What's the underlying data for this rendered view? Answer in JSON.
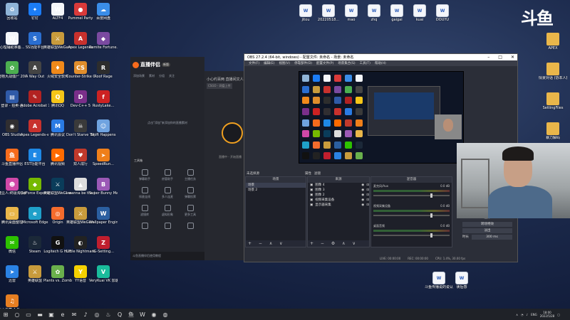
{
  "desktop_left": [
    {
      "label": "回收站",
      "icon": "recycle-bin-icon",
      "color": "#8fb4d8",
      "glyph": "♻"
    },
    {
      "label": "钉钉",
      "icon": "dingtalk-icon",
      "color": "#1b7cf5",
      "glyph": "✦"
    },
    {
      "label": "ALTF4",
      "icon": "document-icon",
      "color": "#f4f6fa",
      "glyph": "W"
    },
    {
      "label": "Pummel Party",
      "icon": "pummel-party-icon",
      "color": "#d93a3a",
      "glyph": "●"
    },
    {
      "label": "百度网盘",
      "icon": "baidu-netdisk-icon",
      "color": "#3a8de8",
      "glyph": "☁"
    },
    {
      "label": "心理辅助准备...",
      "icon": "word-doc-icon",
      "color": "#f4f6fa",
      "glyph": "W"
    },
    {
      "label": "SS功能平台",
      "icon": "ss-icon",
      "color": "#2a6ed0",
      "glyph": "S"
    },
    {
      "label": "英雄联盟WeGame",
      "icon": "lol-icon",
      "color": "#c89b3c",
      "glyph": "⚔"
    },
    {
      "label": "Apex Legends",
      "icon": "apex-icon",
      "color": "#c8312d",
      "glyph": "A"
    },
    {
      "label": "Remite Fortune...",
      "icon": "game-icon",
      "color": "#7a4aa0",
      "glyph": "◆"
    },
    {
      "label": "植物大战僵尸 2002",
      "icon": "pvz-icon",
      "color": "#4caf50",
      "glyph": "✿"
    },
    {
      "label": "A Way Out",
      "icon": "a-way-out-icon",
      "color": "#444",
      "glyph": "A"
    },
    {
      "label": "火绒安全软件",
      "icon": "huorong-icon",
      "color": "#f0891a",
      "glyph": "♦"
    },
    {
      "label": "Counter-Strike Global Off...",
      "icon": "csgo-icon",
      "color": "#e08e2c",
      "glyph": "CS"
    },
    {
      "label": "Roof Rage",
      "icon": "roof-rage-icon",
      "color": "#2d2d2d",
      "glyph": "R"
    },
    {
      "label": "登录 - 拍卖·台",
      "icon": "shortcut-icon",
      "color": "#2f5aa8",
      "glyph": "▤"
    },
    {
      "label": "Adobe Acrobat 7.0",
      "icon": "acrobat-icon",
      "color": "#b22222",
      "glyph": "✎"
    },
    {
      "label": "腾讯QQ",
      "icon": "qq-icon",
      "color": "#f5c518",
      "glyph": "Q"
    },
    {
      "label": "Dev-C++ 5",
      "icon": "devcpp-icon",
      "color": "#7a2f8a",
      "glyph": "D"
    },
    {
      "label": "RustyLake...",
      "icon": "flash-icon",
      "color": "#c22",
      "glyph": "f"
    },
    {
      "label": "OBS Studio",
      "icon": "obs-icon",
      "color": "#302e31",
      "glyph": "◉"
    },
    {
      "label": "Apex Legends-v4",
      "icon": "apex-icon",
      "color": "#c8312d",
      "glyph": "A"
    },
    {
      "label": "腾讯会议",
      "icon": "tencent-meeting-icon",
      "color": "#2a7be4",
      "glyph": "M"
    },
    {
      "label": "Don't Starve Together",
      "icon": "dst-icon",
      "color": "#3a3a3a",
      "glyph": "☠"
    },
    {
      "label": "Shift Happens",
      "icon": "shift-happens-icon",
      "color": "#6fa3e0",
      "glyph": "☺"
    },
    {
      "label": "斗鱼直播伴侣",
      "icon": "douyu-icon",
      "color": "#f76b1c",
      "glyph": "鱼"
    },
    {
      "label": "EST功能平台",
      "icon": "est-icon",
      "color": "#1e88e5",
      "glyph": "E"
    },
    {
      "label": "腾讯视频",
      "icon": "tencent-video-icon",
      "color": "#ff6a00",
      "glyph": "▶"
    },
    {
      "label": "双人成行",
      "icon": "it-takes-two-icon",
      "color": "#c0392b",
      "glyph": "♥"
    },
    {
      "label": "SpeedRun...",
      "icon": "speedrun-icon",
      "color": "#ef7f1a",
      "glyph": "➤"
    },
    {
      "label": "糖豆人:终极淘汰赛",
      "icon": "fall-guys-icon",
      "color": "#d048a8",
      "glyph": "☻"
    },
    {
      "label": "GeForce Experience",
      "icon": "geforce-icon",
      "color": "#76b900",
      "glyph": "◆"
    },
    {
      "label": "英雄联盟WeGame平台",
      "icon": "lol-wegame-icon",
      "color": "#0a3c5a",
      "glyph": "⚔"
    },
    {
      "label": "I wanna be the Creator",
      "icon": "iwanna-icon",
      "color": "#ddd",
      "glyph": "▲"
    },
    {
      "label": "Super Bunny Man",
      "icon": "super-bunny-man-icon",
      "color": "#9b59b6",
      "glyph": "B"
    },
    {
      "label": "腾讯桌面整理",
      "icon": "folder-icon",
      "color": "#e9b64a",
      "glyph": "▭"
    },
    {
      "label": "Microsoft Edge",
      "icon": "edge-icon",
      "color": "#1fa0c9",
      "glyph": "e"
    },
    {
      "label": "Origin",
      "icon": "origin-icon",
      "color": "#f56c2d",
      "glyph": "◎"
    },
    {
      "label": "英雄联盟WeGame版",
      "icon": "lol-icon",
      "color": "#c89b3c",
      "glyph": "⚔"
    },
    {
      "label": "Wallpaper Engine:...",
      "icon": "wallpaper-engine-icon",
      "color": "#2b5fa0",
      "glyph": "W"
    },
    {
      "label": "微信",
      "icon": "wechat-icon",
      "color": "#2dc100",
      "glyph": "✉"
    },
    {
      "label": "Steam",
      "icon": "steam-icon",
      "color": "#1b2838",
      "glyph": "♨"
    },
    {
      "label": "Logitech G HUB",
      "icon": "logitech-icon",
      "color": "#111",
      "glyph": "G"
    },
    {
      "label": "Little Nightmares",
      "icon": "little-nightmares-icon",
      "color": "#222",
      "glyph": "◐"
    },
    {
      "label": "IG-Setting...",
      "icon": "ig-icon",
      "color": "#c01e2e",
      "glyph": "Z"
    },
    {
      "label": "迅雷",
      "icon": "xunlei-icon",
      "color": "#2a82e4",
      "glyph": "➤"
    },
    {
      "label": "英雄联盟",
      "icon": "lol-icon",
      "color": "#c89b3c",
      "glyph": "⚔"
    },
    {
      "label": "Plants vs. Zombies G...",
      "icon": "pvz-gw-icon",
      "color": "#6ab04c",
      "glyph": "✿"
    },
    {
      "label": "YY语音",
      "icon": "yy-icon",
      "color": "#f5d100",
      "glyph": "Y"
    },
    {
      "label": "VeryKuai VK 加速器",
      "icon": "verykuai-icon",
      "color": "#1abc9c",
      "glyph": "V"
    },
    {
      "label": "冰火之舞 A Dance of F...",
      "icon": "dance-of-fire-icon",
      "color": "#e67e22",
      "glyph": "♫"
    }
  ],
  "desktop_top": [
    {
      "label": "jitou",
      "icon": "document-icon"
    },
    {
      "label": "20220518...",
      "icon": "document-icon"
    },
    {
      "label": "mao",
      "icon": "document-icon"
    },
    {
      "label": "zhq",
      "icon": "document-icon"
    },
    {
      "label": "gaigai",
      "icon": "document-icon"
    },
    {
      "label": "kuai",
      "icon": "document-icon"
    },
    {
      "label": "DOUYU",
      "icon": "document-icon"
    }
  ],
  "desktop_right": [
    {
      "label": "APEX",
      "icon": "folder-icon"
    },
    {
      "label": "情景对话 (协本人授权版...",
      "icon": "folder-icon"
    },
    {
      "label": "SettingFiles",
      "icon": "folder-icon"
    },
    {
      "label": "暴力解码",
      "icon": "folder-icon"
    }
  ],
  "desktop_bottom": [
    {
      "label": "斗鱼传播说的说认识",
      "icon": "word-doc-icon"
    },
    {
      "label": "读后感",
      "icon": "word-doc-icon"
    }
  ],
  "brand_watermark": "斗鱼",
  "companion": {
    "title": "直播伴侣",
    "version": "新版",
    "tabs": [
      "添加场景",
      "素材",
      "分组",
      "关注"
    ],
    "empty_text": "点击\"添加\"来添加你的直播素材",
    "tools_title": "工具箱",
    "tools": [
      "弹幕助手",
      "房管助手",
      "主播任务",
      "排麦连线",
      "多人连麦",
      "弹幕投票",
      "滤镜库",
      "虚拟形象",
      "更多工具",
      "",
      "",
      ""
    ],
    "banner": "斗鱼直播伴侣使用教程"
  },
  "side_pane": {
    "title": "小心约百两 直播间文人",
    "subtitle": "CSGO - 网盘上传",
    "hint": "直播中 - 开始直播"
  },
  "obs": {
    "title": "OBS 27.2.4 (64-bit, windows) - 配置文件: 未命名 - 场景: 未命名",
    "menu": [
      "文件(F)",
      "编辑(E)",
      "视图(V)",
      "停靠部件(D)",
      "配置文件(P)",
      "场景集合(S)",
      "工具(T)",
      "帮助(H)"
    ],
    "source_toolbar": [
      "属性",
      "滤镜"
    ],
    "no_source": "未选择源",
    "scenes_header": "场景",
    "scenes": [
      "场景",
      "场景 2"
    ],
    "sources_header": "来源",
    "sources": [
      "图像 4",
      "图像 3",
      "图像 2",
      "视频采集设备",
      "显示器采集"
    ],
    "mixer_header": "混音器",
    "mixer": [
      {
        "name": "麦克风/Aux",
        "db": "0.0 dB"
      },
      {
        "name": "视频采集设备",
        "db": "0.0 dB"
      },
      {
        "name": "桌面音频",
        "db": "0.0 dB"
      }
    ],
    "controls_header": "控件",
    "controls": [
      "开始推流",
      "开始录制",
      "启动虚拟摄像机",
      "工作室模式",
      "设置",
      "退出"
    ],
    "transition_header": "转场特效",
    "transition": "淡出",
    "duration_label": "时长",
    "duration": "300 ms",
    "status": {
      "live": "LIVE: 00:00:00",
      "rec": "REC: 00:00:00",
      "cpu": "CPU: 1.4%, 30.00 fps"
    }
  },
  "taskbar": {
    "apps": [
      {
        "name": "start-button",
        "glyph": "⊞"
      },
      {
        "name": "search-icon",
        "glyph": "○"
      },
      {
        "name": "task-view-icon",
        "glyph": "▭"
      },
      {
        "name": "file-explorer-icon",
        "glyph": "▬"
      },
      {
        "name": "store-icon",
        "glyph": "▣"
      },
      {
        "name": "edge-icon",
        "glyph": "e"
      },
      {
        "name": "wechat-icon",
        "glyph": "✉"
      },
      {
        "name": "tiktok-icon",
        "glyph": "♪"
      },
      {
        "name": "netease-music-icon",
        "glyph": "◎"
      },
      {
        "name": "steam-icon",
        "glyph": "♨"
      },
      {
        "name": "qq-icon",
        "glyph": "Q"
      },
      {
        "name": "douyu-icon",
        "glyph": "鱼"
      },
      {
        "name": "wegame-icon",
        "glyph": "W"
      },
      {
        "name": "obs-icon",
        "glyph": "◉"
      },
      {
        "name": "chrome-icon",
        "glyph": "◍"
      }
    ],
    "lang": "ENG",
    "time": "18:00",
    "date": "2022/5/28"
  }
}
